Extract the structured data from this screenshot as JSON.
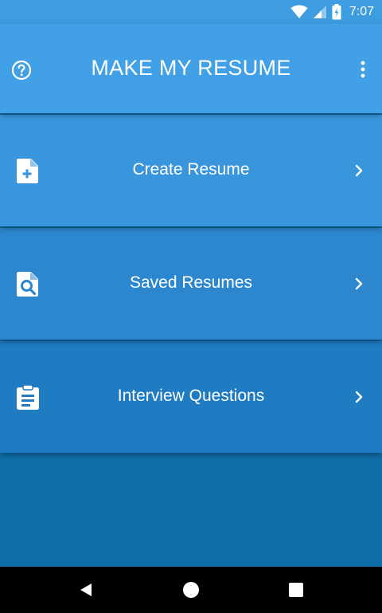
{
  "status_bar": {
    "time": "7:07",
    "icons": [
      "wifi-icon",
      "signal-icon",
      "battery-charging-icon"
    ]
  },
  "app_bar": {
    "title": "MAKE MY RESUME",
    "help_icon": "help-circle-icon",
    "more_icon": "more-vertical-icon"
  },
  "menu": {
    "items": [
      {
        "label": "Create Resume",
        "icon": "file-plus-icon",
        "color": "#3a96dc"
      },
      {
        "label": "Saved Resumes",
        "icon": "file-search-icon",
        "color": "#2c87cf"
      },
      {
        "label": "Interview Questions",
        "icon": "clipboard-icon",
        "color": "#1f7bc2"
      }
    ]
  },
  "colors": {
    "status_bar": "#3d9de0",
    "app_bar": "#42a0e6",
    "background": "#0f6daa",
    "nav_bar": "#000000",
    "text": "#ffffff"
  },
  "nav_bar": {
    "icons": [
      "back-icon",
      "home-icon",
      "recents-icon"
    ]
  }
}
